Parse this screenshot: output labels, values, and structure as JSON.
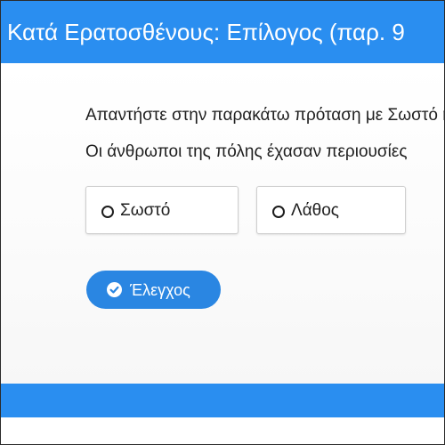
{
  "header": {
    "title": "Κατά Ερατοσθένους: Επίλογος (παρ. 9"
  },
  "question": {
    "instruction": "Απαντήστε στην παρακάτω πρόταση με Σωστό ή Λάθος",
    "statement": "Οι άνθρωποι της πόλης έχασαν περιουσίες"
  },
  "options": [
    {
      "label": "Σωστό",
      "selected": false
    },
    {
      "label": "Λάθος",
      "selected": false
    }
  ],
  "actions": {
    "check_label": "Έλεγχος",
    "check_icon": "check-circle-icon"
  },
  "colors": {
    "header": "#2a8ef0",
    "button": "#2a86e2",
    "footer": "#2a8ef0"
  }
}
